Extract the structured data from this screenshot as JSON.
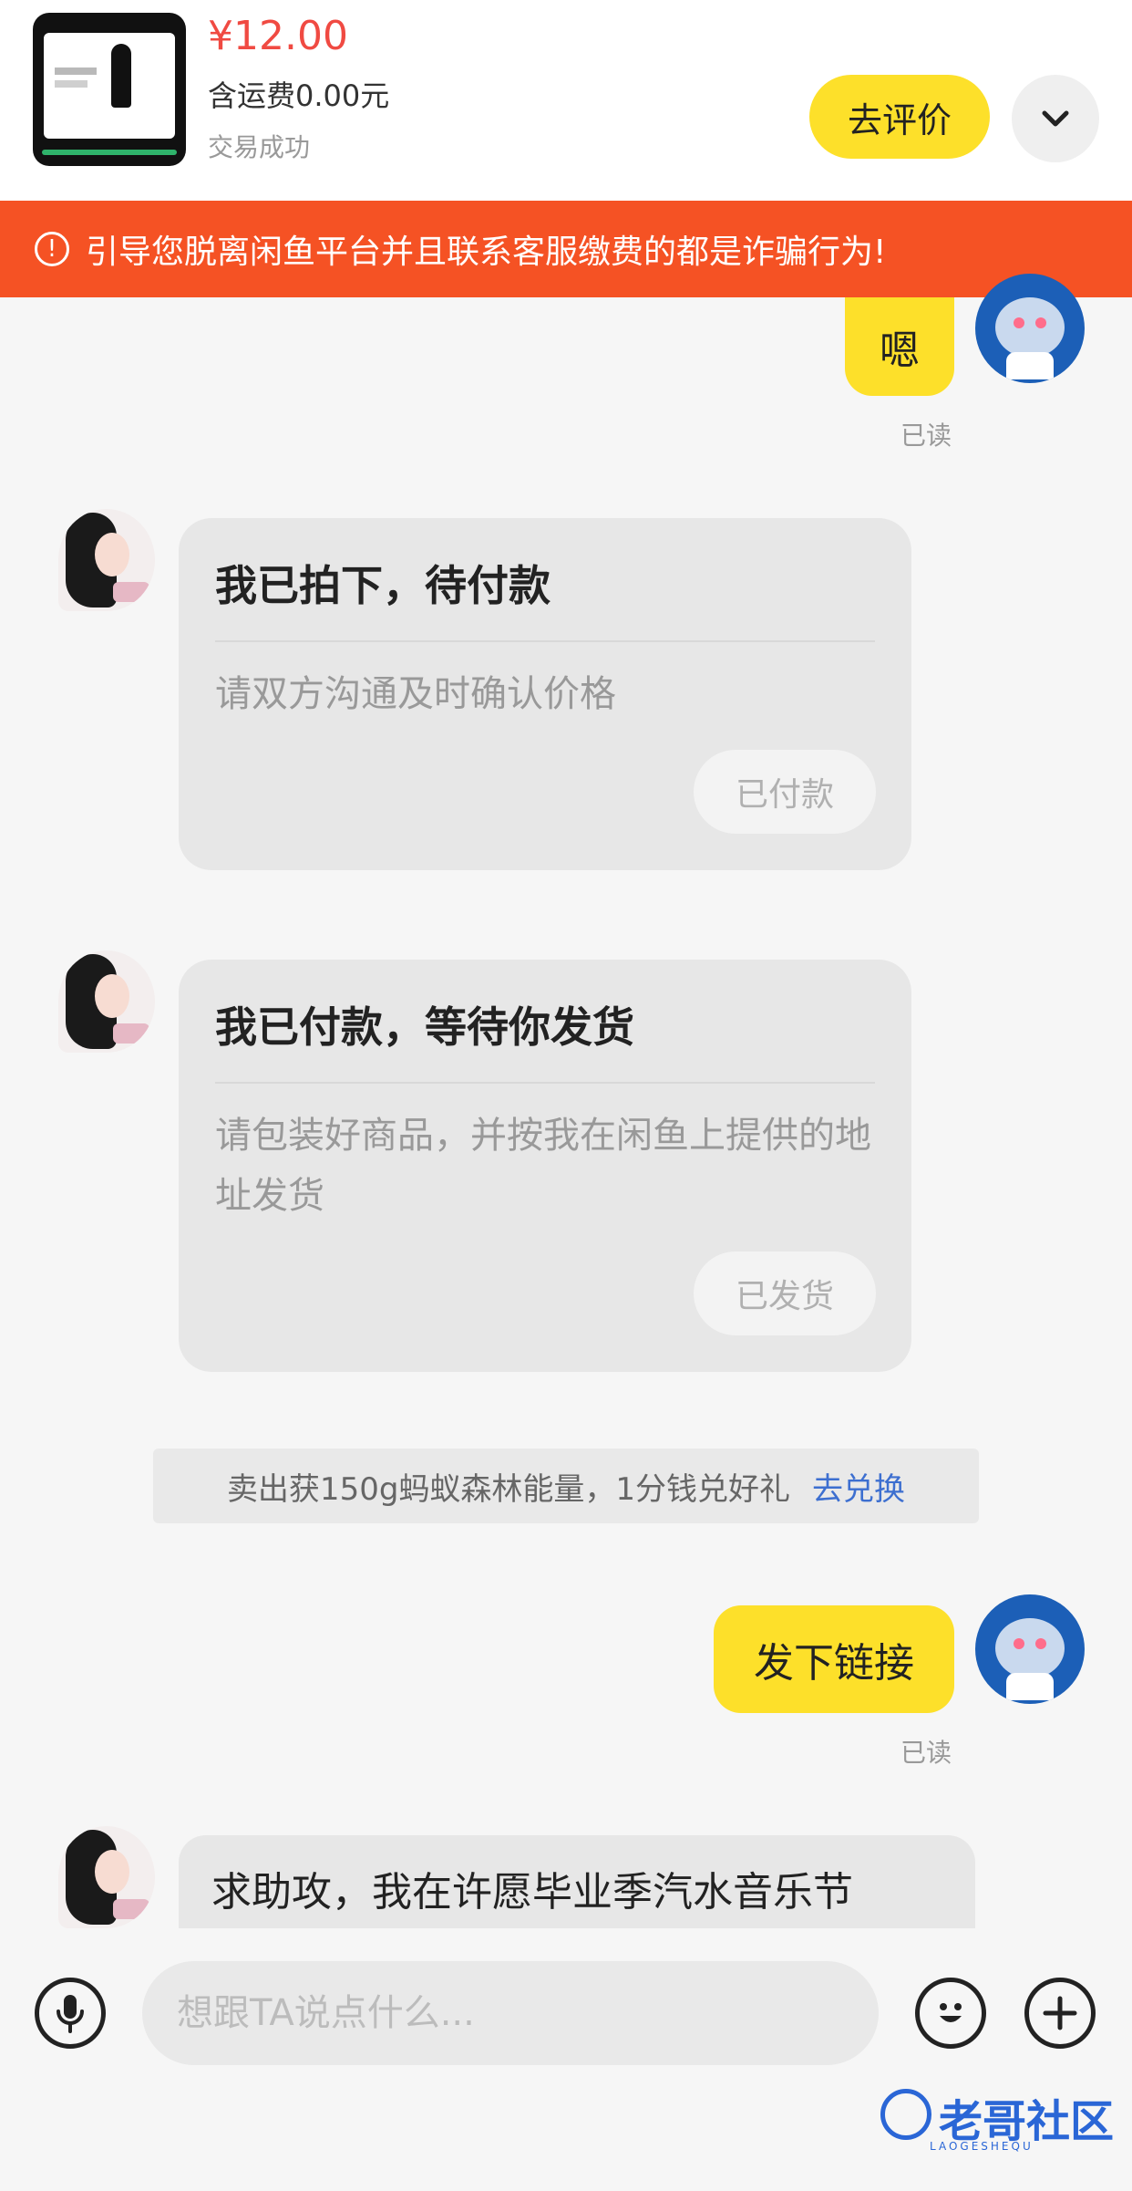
{
  "product": {
    "price": "¥12.00",
    "shipping": "含运费0.00元",
    "status": "交易成功",
    "evaluate_label": "去评价"
  },
  "warning": {
    "icon": "exclamation-circle-icon",
    "text": "引导您脱离闲鱼平台并且联系客服缴费的都是诈骗行为!"
  },
  "messages": {
    "m1": {
      "text": "嗯",
      "read": "已读"
    },
    "card1": {
      "title": "我已拍下，待付款",
      "desc": "请双方沟通及时确认价格",
      "button": "已付款"
    },
    "card2": {
      "title": "我已付款，等待你发货",
      "desc": "请包装好商品，并按我在闲鱼上提供的地址发货",
      "button": "已发货"
    },
    "promo": {
      "text": "卖出获150g蚂蚁森林能量，1分钱兑好礼",
      "link": "去兑换"
    },
    "m2": {
      "text": "发下链接",
      "read": "已读"
    },
    "m3": {
      "text": "求助攻，我在许愿毕业季汽水音乐节"
    }
  },
  "input": {
    "placeholder": "想跟TA说点什么..."
  },
  "watermark": {
    "text": "老哥社区",
    "sub": "LAOGESHEQU"
  },
  "colors": {
    "accent_yellow": "#fde02a",
    "warning_orange": "#f55224",
    "price_red": "#f04a42",
    "link_blue": "#3d6fd0"
  }
}
